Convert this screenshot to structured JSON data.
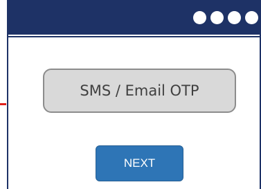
{
  "window": {
    "title_dots": [
      "dot",
      "dot",
      "dot",
      "dot"
    ]
  },
  "form": {
    "otp_placeholder": "SMS / Email OTP",
    "next_label": "NEXT"
  },
  "colors": {
    "titlebar": "#1e3266",
    "field_fill": "#d9d9d9",
    "button_fill": "#2e75b6",
    "connector": "#e0201b"
  }
}
